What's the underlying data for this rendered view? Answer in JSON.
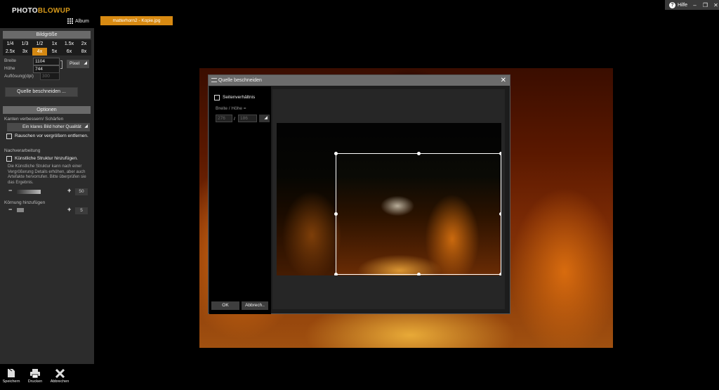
{
  "app": {
    "logo_part1": "PHOTO",
    "logo_part2": "BLOWUP",
    "album_label": "Album",
    "file_tab": "matterhorn2 - Kopie.jpg",
    "help_label": "Hilfe"
  },
  "sidebar": {
    "image_size_header": "Bildgröße",
    "size_row1": [
      "1/4",
      "1/3",
      "1/2",
      "1x",
      "1.5x",
      "2x"
    ],
    "size_row2": [
      "2.5x",
      "3x",
      "4x",
      "5x",
      "6x",
      "8x"
    ],
    "active_size": "4x",
    "width_label": "Breite",
    "width_value": "1104",
    "height_label": "Höhe",
    "height_value": "744",
    "unit_select": "Pixel",
    "resolution_label": "Auflösung(dpi)",
    "resolution_value": "300",
    "crop_button": "Quelle beschneiden ...",
    "options_header": "Optionen",
    "sharpen_label": "Kanten verbessern/ Schärfen",
    "sharpen_select": "Ein klares Bild hoher Qualität",
    "denoise_checkbox": "Rauschen vor vergrößern entfernen.",
    "post_label": "Nachverarbeitung",
    "structure_checkbox": "Künstliche Struktur hinzufügen.",
    "structure_desc": "Die Künstliche Struktur kann nach einer Vergrößerung Details erhöhen, aber auch Artefakte hervorrufen. Bitte überprüfen sie das Ergebnis.",
    "structure_value": "50",
    "grain_label": "Körnung hinzufügen",
    "grain_value": "5"
  },
  "bottom": {
    "save": "Speichern",
    "print": "Drucken",
    "cancel": "Abbrechen"
  },
  "dialog": {
    "title": "Quelle beschneiden",
    "aspect_checkbox": "Seitenverhältnis",
    "ratio_label": "Breite / Höhe =",
    "ratio_w": "276",
    "ratio_sep": "/",
    "ratio_h": "186",
    "ok_button": "OK",
    "cancel_button": "Abbrech.."
  },
  "colors": {
    "accent": "#d88a12",
    "panel": "#2c2c2c",
    "header": "#6a6a6a"
  }
}
